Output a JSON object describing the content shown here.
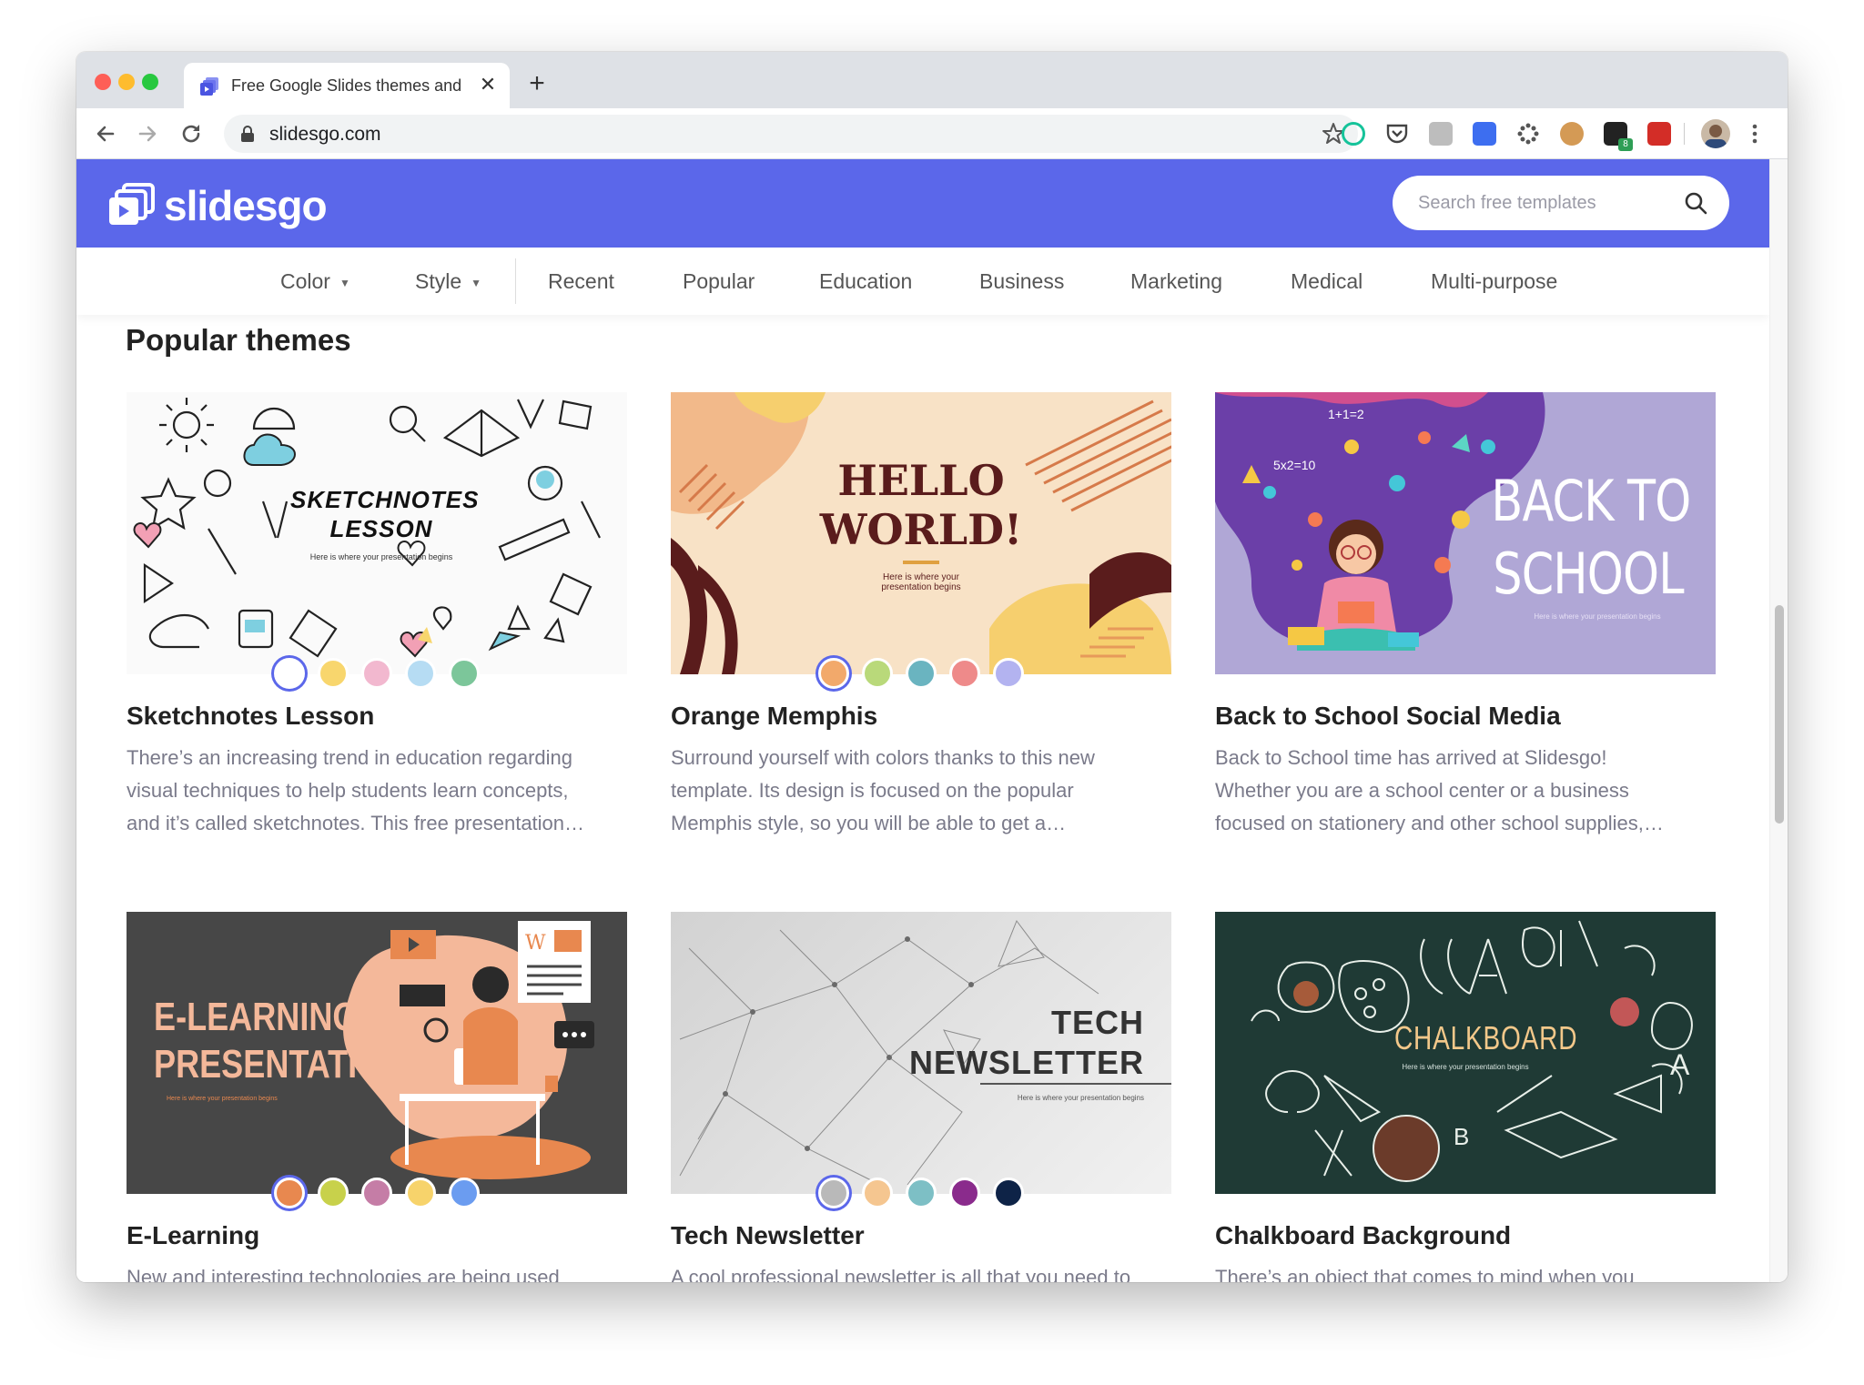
{
  "browser": {
    "tab_title": "Free Google Slides themes and",
    "url": "slidesgo.com",
    "new_tab_label": "+",
    "close_label": "✕"
  },
  "site": {
    "logo_text": "slidesgo",
    "search_placeholder": "Search free templates",
    "nav": {
      "color": "Color",
      "style": "Style",
      "recent": "Recent",
      "popular": "Popular",
      "education": "Education",
      "business": "Business",
      "marketing": "Marketing",
      "medical": "Medical",
      "multipurpose": "Multi-purpose"
    },
    "section_title": "Popular themes"
  },
  "cards": [
    {
      "title": "Sketchnotes Lesson",
      "desc": [
        "There’s an increasing trend in education regarding",
        "visual techniques to help students learn concepts,",
        "and it’s called sketchnotes. This free presentation…"
      ],
      "thumb_title_1": "SKETCHNOTES",
      "thumb_title_2": "LESSON",
      "thumb_sub": "Here is where your presentation begins",
      "swatches": [
        "#ffffff",
        "#f8d66d",
        "#f2b8cf",
        "#b6dcf3",
        "#7cc69a"
      ]
    },
    {
      "title": "Orange Memphis",
      "desc": [
        "Surround yourself with colors thanks to this new",
        "template. Its design is focused on the popular",
        "Memphis style, so you will be able to get a…"
      ],
      "thumb_title_1": "HELLO",
      "thumb_title_2": "WORLD!",
      "thumb_sub": "Here is where your presentation begins",
      "swatches": [
        "#f2a96b",
        "#b9d97a",
        "#6ab4c0",
        "#ee8a8a",
        "#b3b3f0"
      ]
    },
    {
      "title": "Back to School Social Media",
      "desc": [
        "Back to School time has arrived at Slidesgo!",
        "Whether you are a school center or a business",
        "focused on stationery and other school supplies,…"
      ],
      "thumb_title_1": "BACK TO",
      "thumb_title_2": "SCHOOL",
      "thumb_sub": "Here is where your presentation begins",
      "thumb_math_1": "1+1=2",
      "thumb_math_2": "5x2=10",
      "swatches": []
    },
    {
      "title": "E-Learning",
      "desc": [
        "New and interesting technologies are being used"
      ],
      "thumb_title_1": "E-LEARNING",
      "thumb_title_2": "PRESENTATION",
      "thumb_sub": "Here is where your presentation begins",
      "thumb_letter": "W",
      "swatches": [
        "#e8884f",
        "#c8d14b",
        "#c57da6",
        "#f7d36b",
        "#6b9cf0"
      ]
    },
    {
      "title": "Tech Newsletter",
      "desc": [
        "A cool professional newsletter is all that you need to"
      ],
      "thumb_title_1": "TECH",
      "thumb_title_2": "NEWSLETTER",
      "thumb_sub": "Here is where your presentation begins",
      "swatches": [
        "#b9b9b9",
        "#f5c690",
        "#7dbfc5",
        "#8a2b8c",
        "#0e2347"
      ]
    },
    {
      "title": "Chalkboard Background",
      "desc": [
        "There’s an object that comes to mind when you"
      ],
      "thumb_title_1": "CHALKBOARD",
      "thumb_sub": "Here is where your presentation begins",
      "thumb_letter_1": "A",
      "thumb_letter_2": "B",
      "swatches": []
    }
  ],
  "colors": {
    "brand": "#5b67ea",
    "text_dark": "#222222",
    "text_muted": "#7a7a8a"
  }
}
